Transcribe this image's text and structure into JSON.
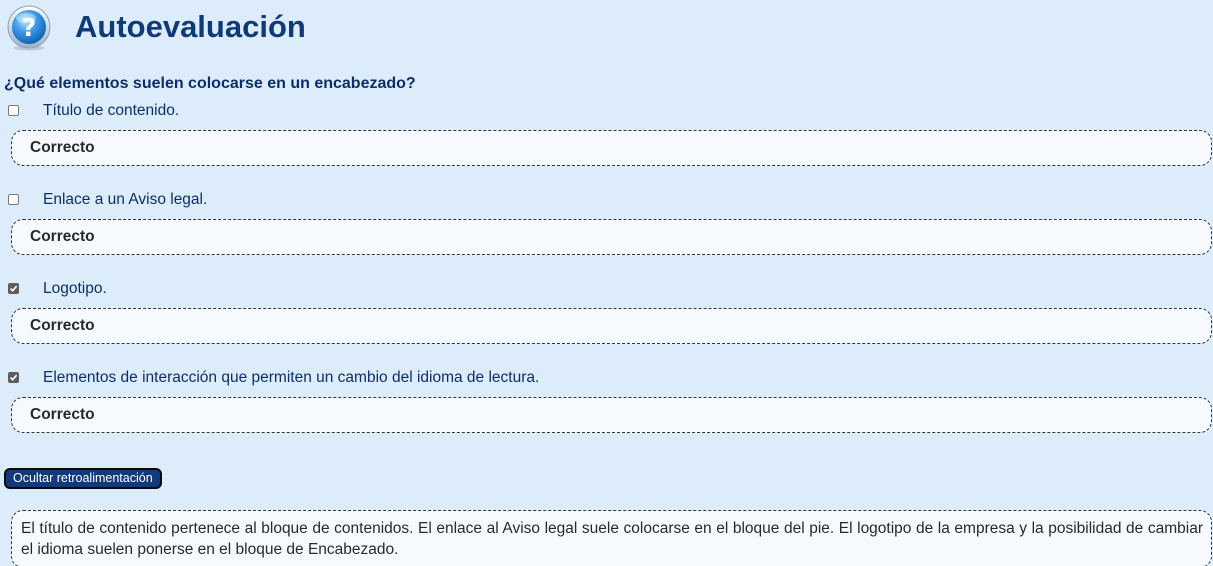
{
  "header": {
    "title": "Autoevaluación",
    "icon": "help-question-icon"
  },
  "question": "¿Qué elementos suelen colocarse en un encabezado?",
  "options": [
    {
      "label": "Título de contenido.",
      "checked": false,
      "feedback": "Correcto"
    },
    {
      "label": "Enlace a un Aviso legal.",
      "checked": false,
      "feedback": "Correcto"
    },
    {
      "label": "Logotipo.",
      "checked": true,
      "feedback": "Correcto"
    },
    {
      "label": "Elementos de interacción que permiten un cambio del idioma de lectura.",
      "checked": true,
      "feedback": "Correcto"
    }
  ],
  "toggle_button": "Ocultar retroalimentación",
  "explanation": "El título de contenido pertenece al bloque de contenidos. El enlace al Aviso legal suele colocarse en el bloque del pie. El logotipo de la empresa y la posibilidad de cambiar el idioma suelen ponerse en el bloque de Encabezado.",
  "colors": {
    "background": "#dcecfa",
    "title": "#0f3a78",
    "text": "#0c2f6b",
    "button": "#113a7a"
  }
}
